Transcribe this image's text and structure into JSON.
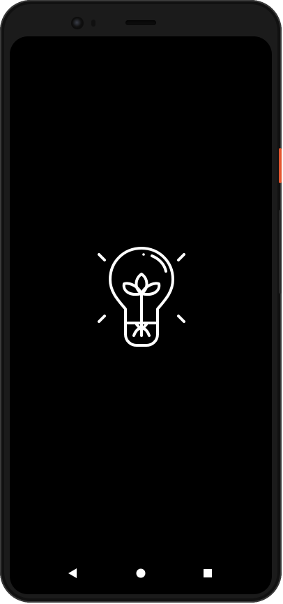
{
  "device": {
    "frame_color": "#1b1b1b",
    "screen_color": "#000000",
    "power_button_color": "#e2562f"
  },
  "splash": {
    "logo_icon": "lightbulb-plant-icon",
    "logo_color": "#ffffff"
  },
  "navigation_bar": {
    "buttons": [
      {
        "name": "back",
        "icon": "triangle-back-icon"
      },
      {
        "name": "home",
        "icon": "circle-home-icon"
      },
      {
        "name": "recents",
        "icon": "square-recents-icon"
      }
    ],
    "color": "#ffffff"
  }
}
